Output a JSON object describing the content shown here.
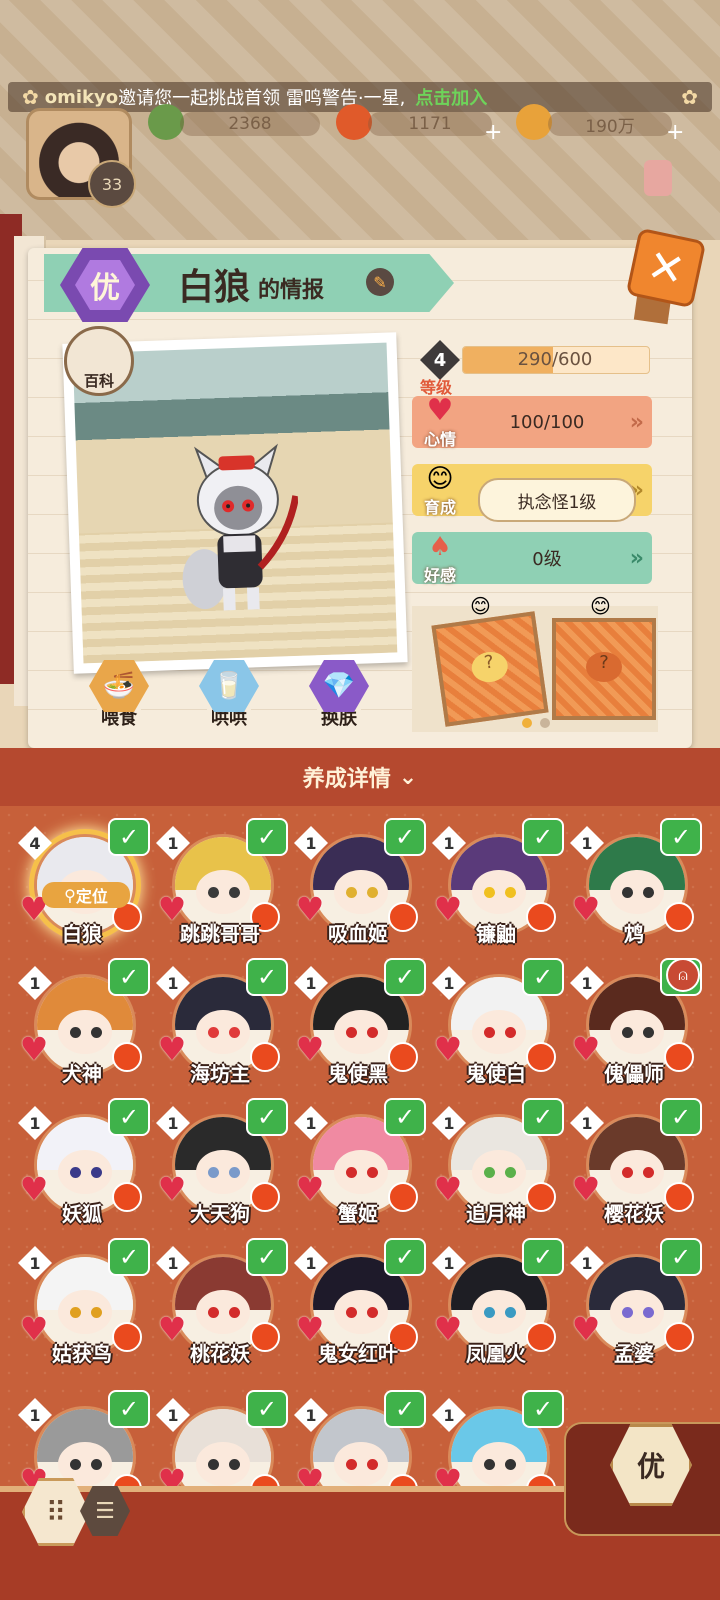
{
  "header": {
    "invite": {
      "player": "omikyo",
      "message": "邀请您一起挑战首领 雷鸣警告·一星,",
      "action": "点击加入"
    },
    "player_level": "33",
    "resources": [
      {
        "icon": "leaf-coin-icon",
        "value": "2368"
      },
      {
        "icon": "magatama-icon",
        "value": "1171"
      },
      {
        "icon": "gold-coin-icon",
        "value": "190万"
      }
    ]
  },
  "profile": {
    "rank": "优",
    "name": "白狼",
    "name_suffix": "的情报",
    "encyclopedia_label": "百科",
    "actions": [
      {
        "label": "喂食",
        "icon": "food-bowl-icon"
      },
      {
        "label": "哄哄",
        "icon": "milk-carton-icon"
      },
      {
        "label": "换肤",
        "icon": "crystal-skin-icon"
      }
    ],
    "stats": {
      "level": {
        "value": "4",
        "label": "等级",
        "exp": "290/600",
        "exp_fraction": 0.483
      },
      "mood": {
        "label": "心情",
        "value": "100/100"
      },
      "nurture": {
        "label": "育成",
        "value": "执念怪1级"
      },
      "affection": {
        "label": "好感",
        "value": "0级"
      }
    },
    "colors": {
      "mood_bg": "#f2a482",
      "nurture_bg": "#f6d36a",
      "affection_bg": "#8fd0b4",
      "exp_fill": "#f0b060"
    }
  },
  "detail_band": {
    "label": "养成详情"
  },
  "grid": {
    "locate_label": "定位",
    "items": [
      {
        "name": "白狼",
        "level": "4",
        "selected": true,
        "hair": "#e9e9ee",
        "eye": "#d32b2b"
      },
      {
        "name": "跳跳哥哥",
        "level": "1",
        "hair": "#e8c24a",
        "eye": "#3a3a3a"
      },
      {
        "name": "吸血姬",
        "level": "1",
        "hair": "#3a2d55",
        "eye": "#e0b030"
      },
      {
        "name": "镰鼬",
        "level": "1",
        "hair": "#5a3a7a",
        "eye": "#f0c020"
      },
      {
        "name": "鸩",
        "level": "1",
        "hair": "#2e7a4a",
        "eye": "#333333"
      },
      {
        "name": "犬神",
        "level": "1",
        "hair": "#e08a3a",
        "eye": "#333333"
      },
      {
        "name": "海坊主",
        "level": "1",
        "hair": "#2a2a3a",
        "eye": "#e03a3a"
      },
      {
        "name": "鬼使黑",
        "level": "1",
        "hair": "#222222",
        "eye": "#d32b2b"
      },
      {
        "name": "鬼使白",
        "level": "1",
        "hair": "#f2f2f2",
        "eye": "#d32b2b"
      },
      {
        "name": "傀儡师",
        "level": "1",
        "hair": "#5a2a1e",
        "eye": "#333333",
        "bell": true
      },
      {
        "name": "妖狐",
        "level": "1",
        "hair": "#f2f2f8",
        "eye": "#3a3a8a"
      },
      {
        "name": "大天狗",
        "level": "1",
        "hair": "#2a2a2a",
        "eye": "#7a9aca"
      },
      {
        "name": "蟹姬",
        "level": "1",
        "hair": "#f08aa2",
        "eye": "#d32b2b"
      },
      {
        "name": "追月神",
        "level": "1",
        "hair": "#eae6e0",
        "eye": "#5ab04a"
      },
      {
        "name": "樱花妖",
        "level": "1",
        "hair": "#6a3a2a",
        "eye": "#d32b2b"
      },
      {
        "name": "姑获鸟",
        "level": "1",
        "hair": "#f4f4f4",
        "eye": "#e0a020"
      },
      {
        "name": "桃花妖",
        "level": "1",
        "hair": "#8a3a32",
        "eye": "#d32b2b"
      },
      {
        "name": "鬼女红叶",
        "level": "1",
        "hair": "#1e1a2a",
        "eye": "#d32b2b"
      },
      {
        "name": "凤凰火",
        "level": "1",
        "hair": "#1e1e24",
        "eye": "#3a9ac2"
      },
      {
        "name": "孟婆",
        "level": "1",
        "hair": "#2a2a3a",
        "eye": "#7a6ad0"
      },
      {
        "name": "",
        "level": "1",
        "hair": "#9a9a9a",
        "eye": "#333333"
      },
      {
        "name": "",
        "level": "1",
        "hair": "#e8e0d8",
        "eye": "#333333"
      },
      {
        "name": "",
        "level": "1",
        "hair": "#c2c6cc",
        "eye": "#d32b2b"
      },
      {
        "name": "",
        "level": "1",
        "hair": "#6ac8e8",
        "eye": "#333333"
      }
    ]
  },
  "bottom_bar": {
    "rank_filter": "优",
    "grid_icon": "grid-view-icon",
    "list_icon": "list-view-icon"
  }
}
